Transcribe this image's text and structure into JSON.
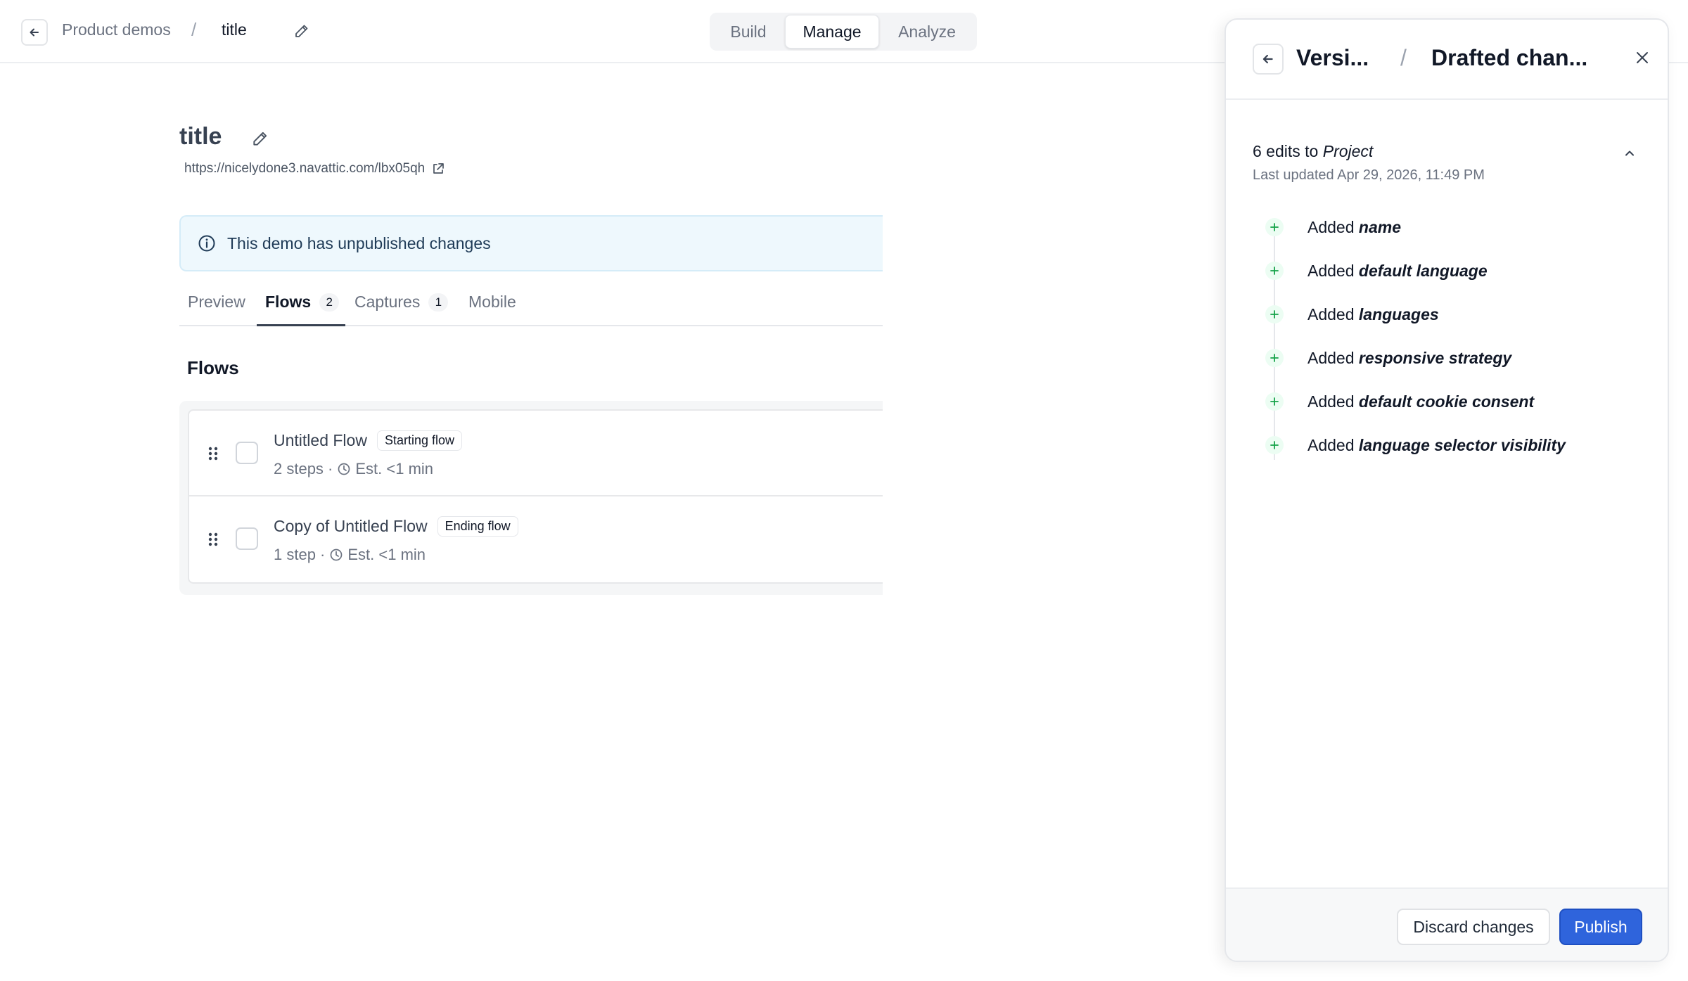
{
  "topbar": {
    "breadcrumb_root": "Product demos",
    "breadcrumb_sep": "/",
    "breadcrumb_current": "title",
    "icons": {
      "back": "arrow-left-icon",
      "edit": "pencil-icon"
    }
  },
  "modes": {
    "build": "Build",
    "manage": "Manage",
    "analyze": "Analyze",
    "active": "Manage"
  },
  "demo": {
    "title": "title",
    "url": "https://nicelydone3.navattic.com/lbx05qh"
  },
  "banner": {
    "text": "This demo has unpublished changes"
  },
  "tabs": {
    "preview": "Preview",
    "flows": "Flows",
    "flows_count": "2",
    "captures": "Captures",
    "captures_count": "1",
    "mobile": "Mobile",
    "active": "Flows"
  },
  "flows_section": {
    "title": "Flows",
    "items": [
      {
        "name": "Untitled Flow",
        "badge": "Starting flow",
        "steps": "2 steps ·",
        "est": "Est. <1 min"
      },
      {
        "name": "Copy of Untitled Flow",
        "badge": "Ending flow",
        "steps": "1 step ·",
        "est": "Est. <1 min"
      }
    ]
  },
  "panel": {
    "crumb1": "Versi...",
    "crumb_sep": "/",
    "crumb2": "Drafted chan...",
    "edits_prefix": "6 edits to ",
    "edits_target": "Project",
    "last_updated": "Last updated Apr 29, 2026, 11:49 PM",
    "edits": [
      {
        "verb": "Added",
        "field": "name"
      },
      {
        "verb": "Added",
        "field": "default language"
      },
      {
        "verb": "Added",
        "field": "languages"
      },
      {
        "verb": "Added",
        "field": "responsive strategy"
      },
      {
        "verb": "Added",
        "field": "default cookie consent"
      },
      {
        "verb": "Added",
        "field": "language selector visibility"
      }
    ],
    "discard_label": "Discard changes",
    "publish_label": "Publish",
    "colors": {
      "publish_bg": "#2f64dc",
      "plus": "#16a34a"
    }
  }
}
